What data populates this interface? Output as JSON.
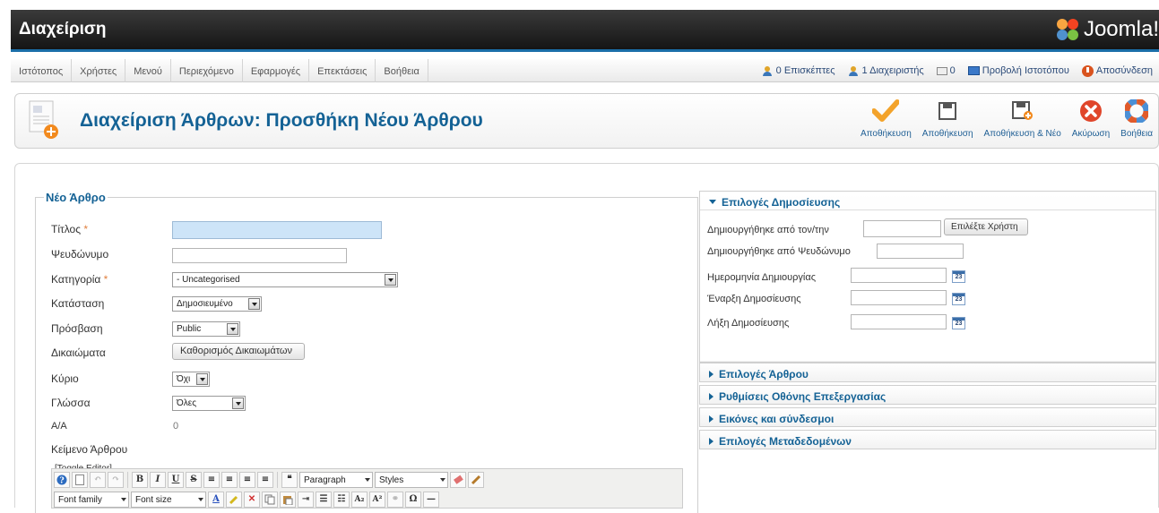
{
  "header": {
    "title": "Διαχείριση",
    "brand": "Joomla!"
  },
  "menu": [
    "Ιστότοπος",
    "Χρήστες",
    "Μενού",
    "Περιεχόμενο",
    "Εφαρμογές",
    "Επεκτάσεις",
    "Βοήθεια"
  ],
  "status": {
    "visitors": "0 Επισκέπτες",
    "admins": "1 Διαχειριστής",
    "messages": "0",
    "view_site": "Προβολή Ιστοτόπου",
    "logout": "Αποσύνδεση"
  },
  "toolbar": {
    "page_title": "Διαχείριση Άρθρων: Προσθήκη Νέου Άρθρου",
    "buttons": {
      "apply": "Αποθήκευση",
      "save": "Αποθήκευση",
      "save_new": "Αποθήκευση & Νέο",
      "cancel": "Ακύρωση",
      "help": "Βοήθεια"
    }
  },
  "form": {
    "legend": "Νέο Άρθρο",
    "title_label": "Τίτλος",
    "required_mark": "*",
    "alias_label": "Ψευδώνυμο",
    "category_label": "Κατηγορία",
    "category_value": "- Uncategorised",
    "status_label": "Κατάσταση",
    "status_value": "Δημοσιευμένο",
    "access_label": "Πρόσβαση",
    "access_value": "Public",
    "permissions_label": "Δικαιώματα",
    "permissions_button": "Καθορισμός Δικαιωμάτων",
    "featured_label": "Κύριο",
    "featured_value": "Όχι",
    "language_label": "Γλώσσα",
    "language_value": "Όλες",
    "id_label": "Α/Α",
    "id_value": "0",
    "text_label": "Κείμενο Άρθρου",
    "toggle_editor": "[Toggle Editor]"
  },
  "editor": {
    "format_select": "Paragraph",
    "styles_select": "Styles",
    "font_family": "Font family",
    "font_size": "Font size"
  },
  "publishing": {
    "heading": "Επιλογές Δημοσίευσης",
    "created_by_label": "Δημιουργήθηκε από τον/την",
    "select_user_button": "Επιλέξτε Χρήστη",
    "created_by_alias_label": "Δημιουργήθηκε από Ψευδώνυμο",
    "created_date_label": "Ημερομηνία Δημιουργίας",
    "publish_up_label": "Έναρξη Δημοσίευσης",
    "publish_down_label": "Λήξη Δημοσίευσης",
    "calendar_day": "23"
  },
  "panels": [
    "Επιλογές Άρθρου",
    "Ρυθμίσεις Οθόνης Επεξεργασίας",
    "Εικόνες και σύνδεσμοι",
    "Επιλογές Μεταδεδομένων"
  ]
}
